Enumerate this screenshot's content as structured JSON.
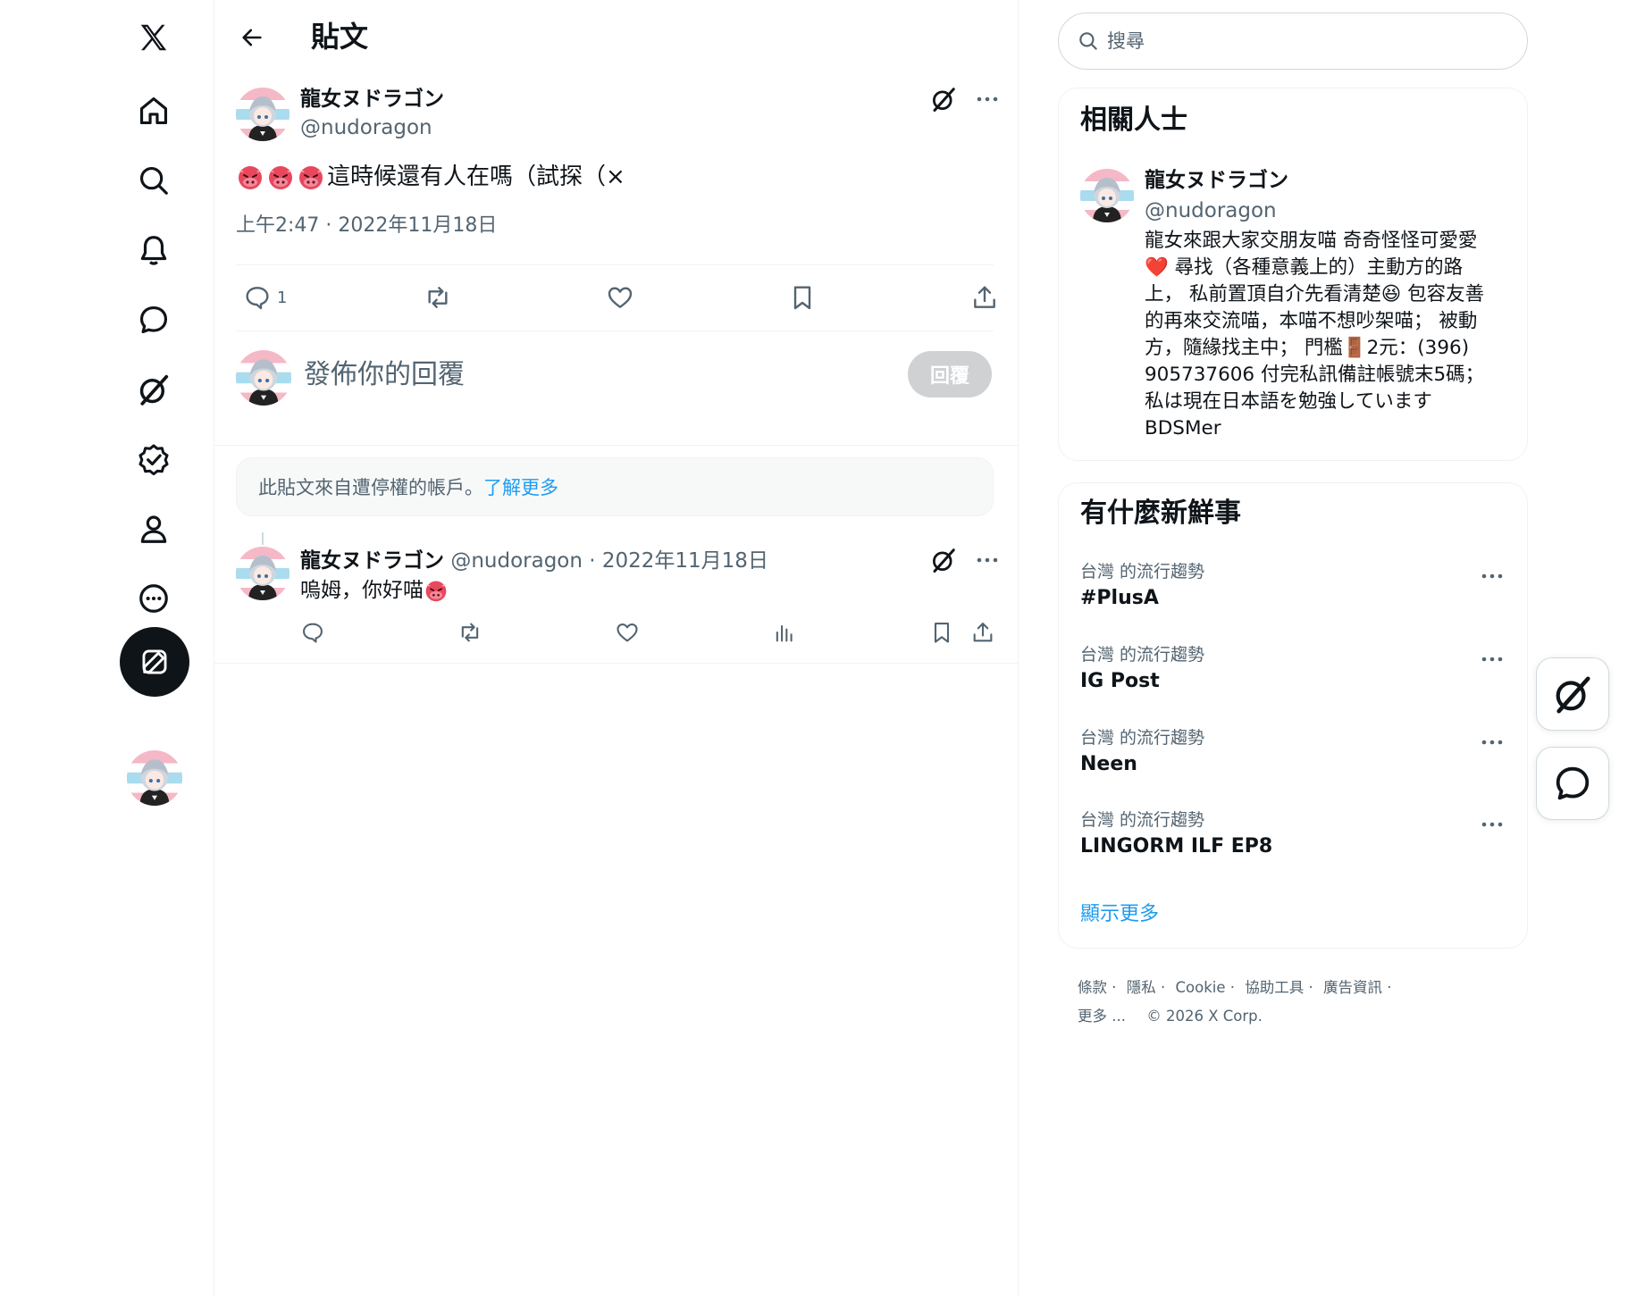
{
  "nav": {
    "items": [
      {
        "icon": "x-logo-icon"
      },
      {
        "icon": "home-icon"
      },
      {
        "icon": "search-icon"
      },
      {
        "icon": "bell-icon"
      },
      {
        "icon": "message-icon"
      },
      {
        "icon": "grok-icon"
      },
      {
        "icon": "verified-icon"
      },
      {
        "icon": "profile-icon"
      },
      {
        "icon": "more-icon"
      }
    ],
    "compose_icon": "compose-icon"
  },
  "header": {
    "title": "貼文"
  },
  "post": {
    "author_name": "龍女ヌドラゴン",
    "author_handle": "@nudoragon",
    "text": "這時候還有人在嗎（試探（×",
    "timestamp": "上午2:47 · 2022年11月18日",
    "reply_count": "1"
  },
  "composer": {
    "placeholder": "發佈你的回覆",
    "button_label": "回覆"
  },
  "notice": {
    "text": "此貼文來自遭停權的帳戶。",
    "link": "了解更多"
  },
  "reply": {
    "author_name": "龍女ヌドラゴン",
    "author_handle": "@nudoragon",
    "date": "· 2022年11月18日",
    "text": "嗚姆，你好喵"
  },
  "search": {
    "placeholder": "搜尋"
  },
  "related": {
    "title": "相關人士",
    "name": "龍女ヌドラゴン",
    "handle": "@nudoragon",
    "bio": "龍女來跟大家交朋友喵 奇奇怪怪可愛愛\n❤️ 尋找（各種意義上的）主動方的路\n上， 私前置頂自介先看清楚😆 包容友善\n的再來交流喵，本喵不想吵架喵； 被動\n方，隨緣找主中； 門檻🚪2元：(396)\n905737606 付完私訊備註帳號末5碼；\n私は現在日本語を勉強しています\nBDSMer"
  },
  "trends": {
    "title": "有什麼新鮮事",
    "items": [
      {
        "category": "台灣 的流行趨勢",
        "name": "#PlusA"
      },
      {
        "category": "台灣 的流行趨勢",
        "name": "IG Post"
      },
      {
        "category": "台灣 的流行趨勢",
        "name": "Neen"
      },
      {
        "category": "台灣 的流行趨勢",
        "name": "LINGORM ILF EP8"
      }
    ],
    "show_more": "顯示更多"
  },
  "footer": {
    "terms": "條款",
    "privacy": "隱私",
    "cookie": "Cookie",
    "accessibility": "協助工具",
    "ads": "廣告資訊",
    "more": "更多 ...",
    "copyright": "© 2026 X Corp."
  },
  "colors": {
    "accent": "#1d9bf0",
    "text": "#0f1419",
    "secondary": "#536471",
    "border": "#eff3f4"
  }
}
